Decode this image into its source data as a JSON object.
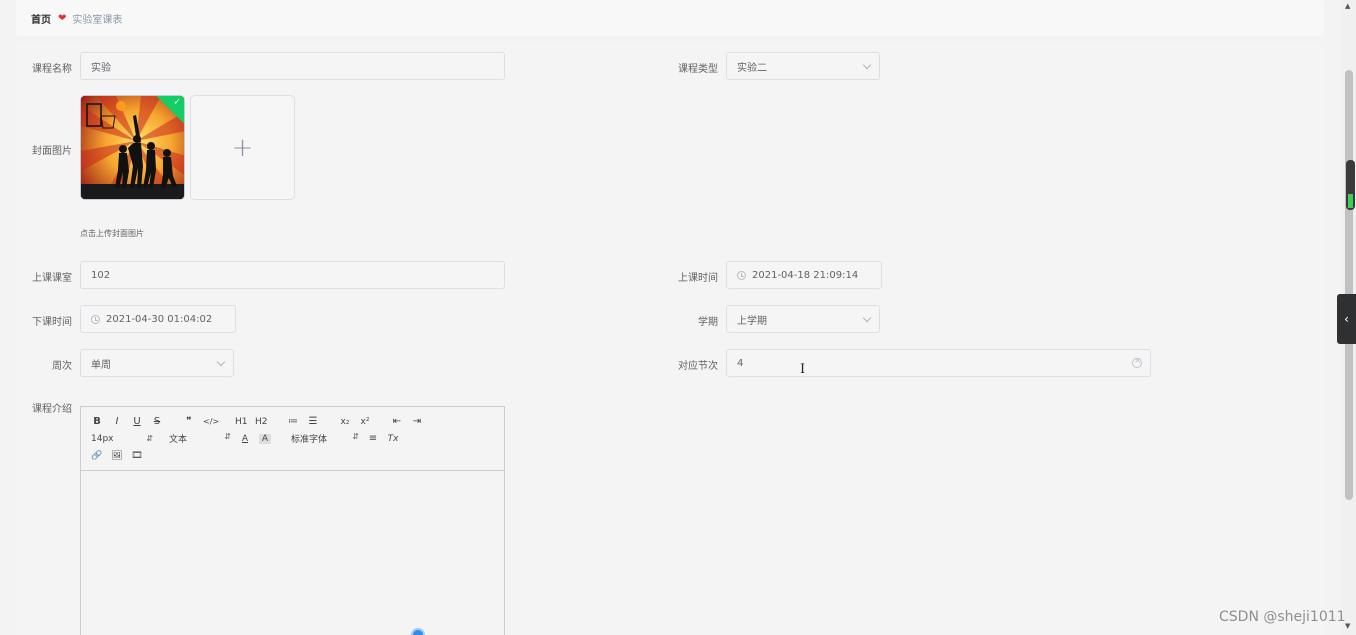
{
  "breadcrumb": {
    "home": "首页",
    "current": "实验室课表"
  },
  "form": {
    "course_name": {
      "label": "课程名称",
      "value": "实验"
    },
    "course_type": {
      "label": "课程类型",
      "value": "实验二"
    },
    "cover": {
      "label": "封面图片",
      "tip": "点击上传封面图片",
      "plus": "+"
    },
    "classroom": {
      "label": "上课课室",
      "value": "102"
    },
    "start_time": {
      "label": "上课时间",
      "value": "2021-04-18 21:09:14"
    },
    "end_time": {
      "label": "下课时间",
      "value": "2021-04-30 01:04:02"
    },
    "semester": {
      "label": "学期",
      "value": "上学期"
    },
    "week": {
      "label": "周次",
      "value": "单周"
    },
    "section": {
      "label": "对应节次",
      "value": "4"
    },
    "intro": {
      "label": "课程介绍"
    }
  },
  "editor": {
    "row1": [
      "B",
      "I",
      "U",
      "S",
      "❞",
      "</>",
      "H1",
      "H2",
      "≔",
      "☰",
      "x₂",
      "x²",
      "⇤",
      "⇥"
    ],
    "font_size": "14px",
    "block_format": "文本",
    "font_family": "标准字体",
    "color_icon": "A",
    "bg_icon": "A",
    "align_icon": "≡",
    "clear_icon": "Tx",
    "row3": [
      "🔗",
      "🖼",
      "🎞"
    ]
  },
  "watermark": "CSDN @sheji1011",
  "colors": {
    "success": "#13ce66",
    "heart": "#e0303b",
    "accent": "#2d8cf0"
  }
}
